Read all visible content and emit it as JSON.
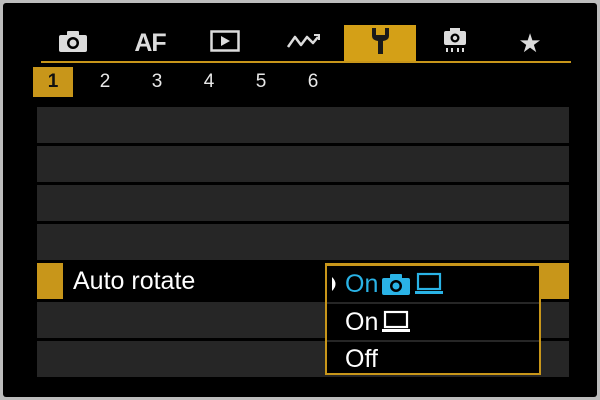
{
  "tabs": [
    {
      "id": "shooting",
      "icon": "camera-icon"
    },
    {
      "id": "af",
      "label": "AF"
    },
    {
      "id": "playback",
      "icon": "play-icon"
    },
    {
      "id": "custom",
      "icon": "wave-icon"
    },
    {
      "id": "setup",
      "icon": "wrench-icon",
      "active": true
    },
    {
      "id": "function",
      "icon": "custom-function-icon"
    },
    {
      "id": "mymenu",
      "icon": "star-icon",
      "label": "★"
    }
  ],
  "pages": [
    "1",
    "2",
    "3",
    "4",
    "5",
    "6"
  ],
  "active_page": "1",
  "setting": {
    "label": "Auto rotate"
  },
  "options": [
    {
      "label": "On",
      "icons": [
        "camera-icon",
        "computer-icon"
      ],
      "selected": true
    },
    {
      "label": "On",
      "icons": [
        "computer-icon"
      ],
      "selected": false
    },
    {
      "label": "Off",
      "icons": [],
      "selected": false
    }
  ],
  "colors": {
    "accent": "#c8961a",
    "selected_option": "#2ab3e6",
    "row_background": "#262626",
    "screen_background": "#000000"
  }
}
